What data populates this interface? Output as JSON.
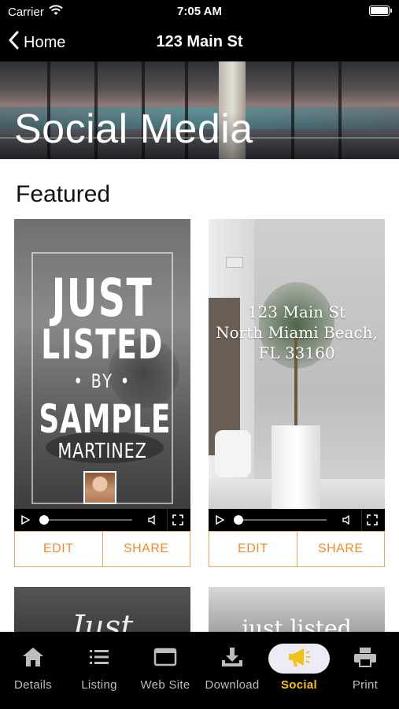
{
  "status_bar": {
    "carrier": "Carrier",
    "time": "7:05 AM"
  },
  "nav": {
    "back_label": "Home",
    "title": "123 Main St"
  },
  "hero": {
    "title": "Social Media"
  },
  "featured": {
    "title": "Featured",
    "cards": [
      {
        "kind": "just-listed",
        "lines": [
          "JUST",
          "LISTED",
          "• BY •",
          "SAMPLE",
          "MARTINEZ"
        ],
        "edit_label": "EDIT",
        "share_label": "SHARE"
      },
      {
        "kind": "address",
        "lines": [
          "123 Main St",
          "North Miami Beach,",
          "FL 33160"
        ],
        "edit_label": "EDIT",
        "share_label": "SHARE"
      }
    ]
  },
  "more_cards": {
    "left_text": "Just",
    "right_text": "just listed"
  },
  "tab_bar": {
    "active": "Social",
    "accent_color": "#f3c11b",
    "items": [
      {
        "label": "Details",
        "icon": "house-icon"
      },
      {
        "label": "Listing",
        "icon": "list-icon"
      },
      {
        "label": "Web Site",
        "icon": "browser-window-icon"
      },
      {
        "label": "Download",
        "icon": "download-tray-icon"
      },
      {
        "label": "Social",
        "icon": "megaphone-icon"
      },
      {
        "label": "Print",
        "icon": "printer-icon"
      }
    ]
  },
  "colors": {
    "action_orange": "#ef8a2a",
    "bars": "#000000"
  }
}
